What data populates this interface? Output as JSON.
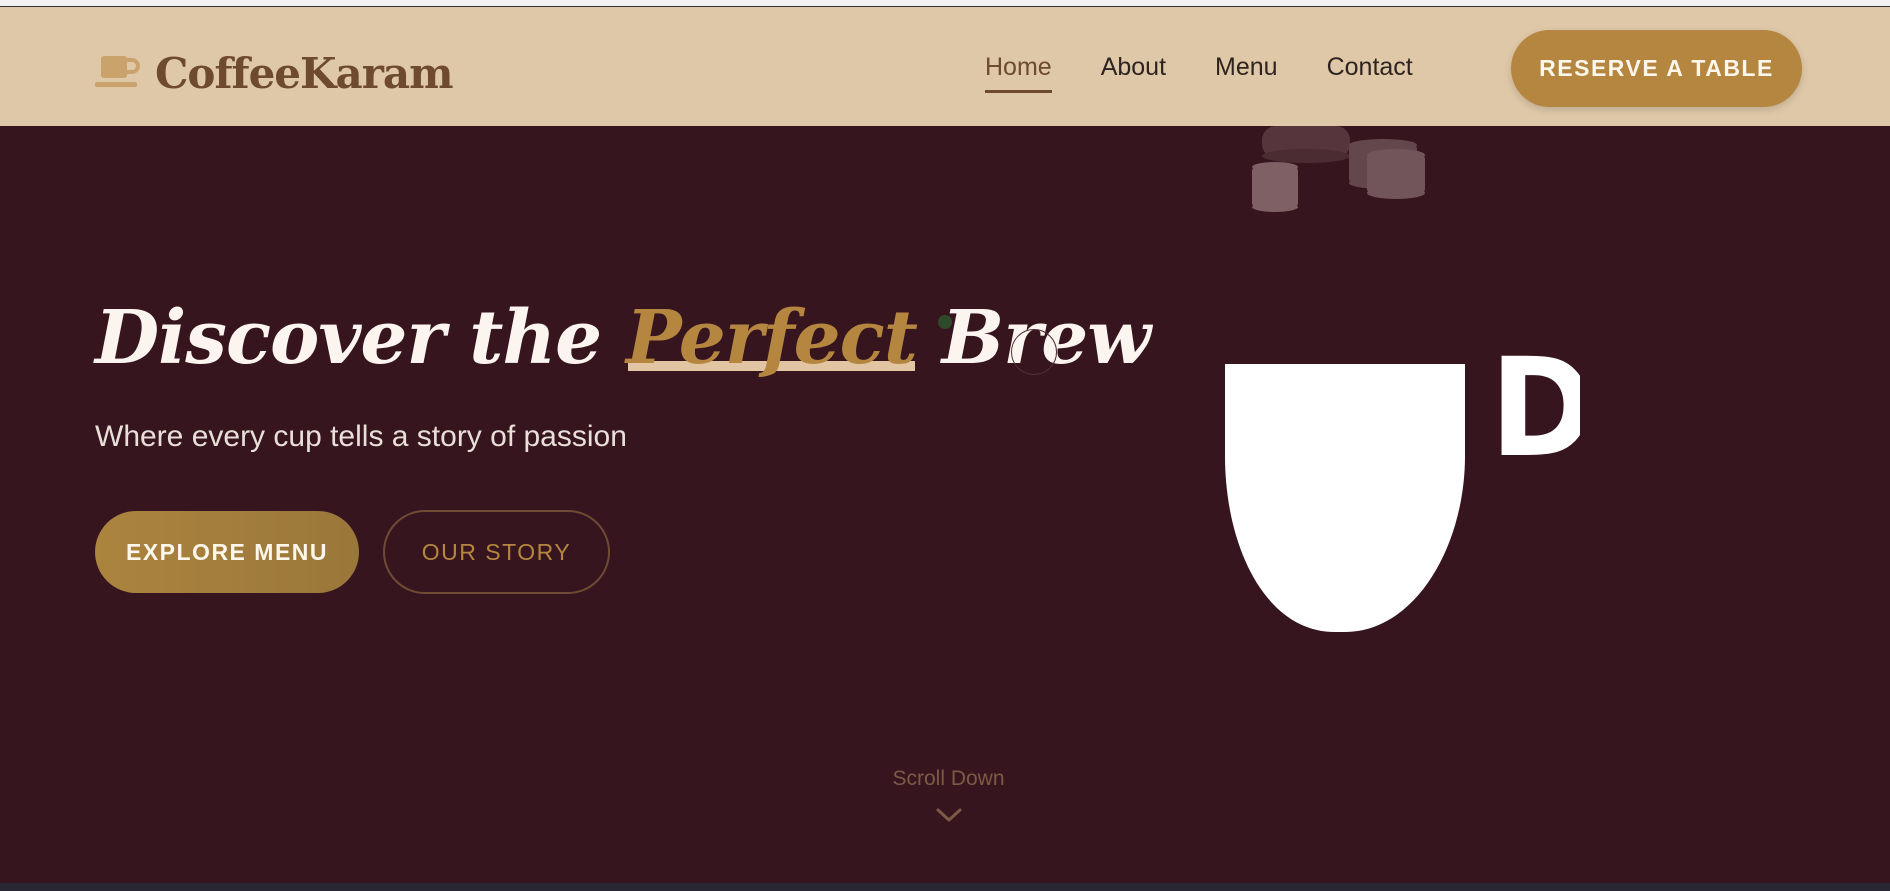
{
  "brand": {
    "name": "CoffeeKaram",
    "icon": "coffee-cup-icon",
    "color": "#6e4a2e"
  },
  "nav": {
    "items": [
      {
        "label": "Home",
        "active": true
      },
      {
        "label": "About",
        "active": false
      },
      {
        "label": "Menu",
        "active": false
      },
      {
        "label": "Contact",
        "active": false
      }
    ],
    "cta_label": "RESERVE A TABLE"
  },
  "hero": {
    "title_prefix": "Discover the",
    "title_accent": "Perfect",
    "title_suffix": "Brew",
    "subtitle": "Where every cup tells a story of passion",
    "primary_button": "EXPLORE MENU",
    "secondary_button": "OUR STORY",
    "cup_letter": "D"
  },
  "scroll": {
    "label": "Scroll Down",
    "icon": "chevron-down-icon"
  },
  "colors": {
    "background": "#36151e",
    "navbar": "#dfc8a8",
    "accent": "#b5863f",
    "text_light": "#fbf4ef"
  }
}
